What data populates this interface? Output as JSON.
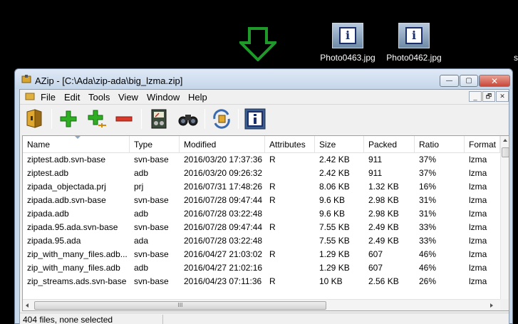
{
  "desktop": {
    "icons": [
      {
        "label": "Photo0463.jpg",
        "icon": "image-info-icon"
      },
      {
        "label": "Photo0462.jpg",
        "icon": "image-info-icon"
      }
    ],
    "stray_label": "s"
  },
  "window": {
    "title": "AZip - [C:\\Ada\\zip-ada\\big_lzma.zip]",
    "controls": {
      "minimize": "—",
      "maximize": "▢",
      "close": "✕"
    }
  },
  "menu": {
    "items": [
      "File",
      "Edit",
      "Tools",
      "View",
      "Window",
      "Help"
    ],
    "mdi": {
      "minimize": "_",
      "restore": "🗗",
      "close": "✕"
    }
  },
  "toolbar": {
    "buttons": [
      "open-archive-icon",
      "add-files-icon",
      "add-files-encrypted-icon",
      "delete-icon",
      "test-archive-icon",
      "find-icon",
      "recompress-icon",
      "properties-icon"
    ]
  },
  "list": {
    "columns": [
      "Name",
      "Type",
      "Modified",
      "Attributes",
      "Size",
      "Packed",
      "Ratio",
      "Format"
    ],
    "rows": [
      [
        "ziptest.adb.svn-base",
        "svn-base",
        "2016/03/20  17:37:36",
        "R",
        "2.42 KB",
        "911",
        "37%",
        "lzma"
      ],
      [
        "ziptest.adb",
        "adb",
        "2016/03/20  09:26:32",
        "",
        "2.42 KB",
        "911",
        "37%",
        "lzma"
      ],
      [
        "zipada_objectada.prj",
        "prj",
        "2016/07/31  17:48:26",
        "R",
        "8.06 KB",
        "1.32 KB",
        "16%",
        "lzma"
      ],
      [
        "zipada.adb.svn-base",
        "svn-base",
        "2016/07/28  09:47:44",
        "R",
        "9.6 KB",
        "2.98 KB",
        "31%",
        "lzma"
      ],
      [
        "zipada.adb",
        "adb",
        "2016/07/28  03:22:48",
        "",
        "9.6 KB",
        "2.98 KB",
        "31%",
        "lzma"
      ],
      [
        "zipada.95.ada.svn-base",
        "svn-base",
        "2016/07/28  09:47:44",
        "R",
        "7.55 KB",
        "2.49 KB",
        "33%",
        "lzma"
      ],
      [
        "zipada.95.ada",
        "ada",
        "2016/07/28  03:22:48",
        "",
        "7.55 KB",
        "2.49 KB",
        "33%",
        "lzma"
      ],
      [
        "zip_with_many_files.adb...",
        "svn-base",
        "2016/04/27  21:03:02",
        "R",
        "1.29 KB",
        "607",
        "46%",
        "lzma"
      ],
      [
        "zip_with_many_files.adb",
        "adb",
        "2016/04/27  21:02:16",
        "",
        "1.29 KB",
        "607",
        "46%",
        "lzma"
      ],
      [
        "zip_streams.ads.svn-base",
        "svn-base",
        "2016/04/23  07:11:36",
        "R",
        "10 KB",
        "2.56 KB",
        "26%",
        "lzma"
      ]
    ],
    "hscroll_grip": "III"
  },
  "status": {
    "text": "404 files, none selected"
  },
  "colors": {
    "arrow": "#1f9a2a",
    "titlebar": "#c5d6ea",
    "close_button": "#c9473a"
  }
}
